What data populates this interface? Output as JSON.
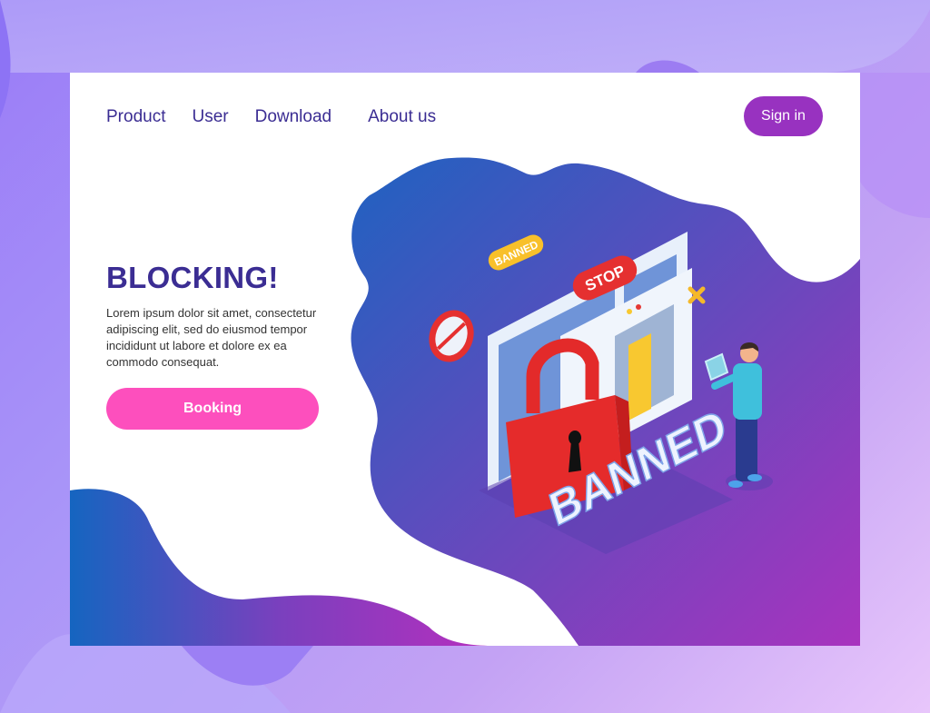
{
  "nav": {
    "items": [
      {
        "label": "Product"
      },
      {
        "label": "User"
      },
      {
        "label": "Download"
      },
      {
        "label": "About us"
      }
    ],
    "signin_label": "Sign in"
  },
  "hero": {
    "title": "BLOCKING!",
    "description": "Lorem ipsum dolor sit amet, consectetur adipiscing elit, sed do eiusmod tempor incididunt ut labore et dolore ex ea commodo consequat.",
    "cta_label": "Booking"
  },
  "illustration": {
    "banned_badge": "BANNED",
    "stop_badge": "STOP",
    "banned_letters": "BANNED"
  },
  "colors": {
    "nav_text": "#3b2d93",
    "signin_bg": "#9832c0",
    "cta_bg": "#fd4fbd",
    "lock_red": "#e52b2b",
    "badge_yellow": "#f8c02a",
    "blob_start": "#1f62c0",
    "blob_end": "#a833be"
  }
}
